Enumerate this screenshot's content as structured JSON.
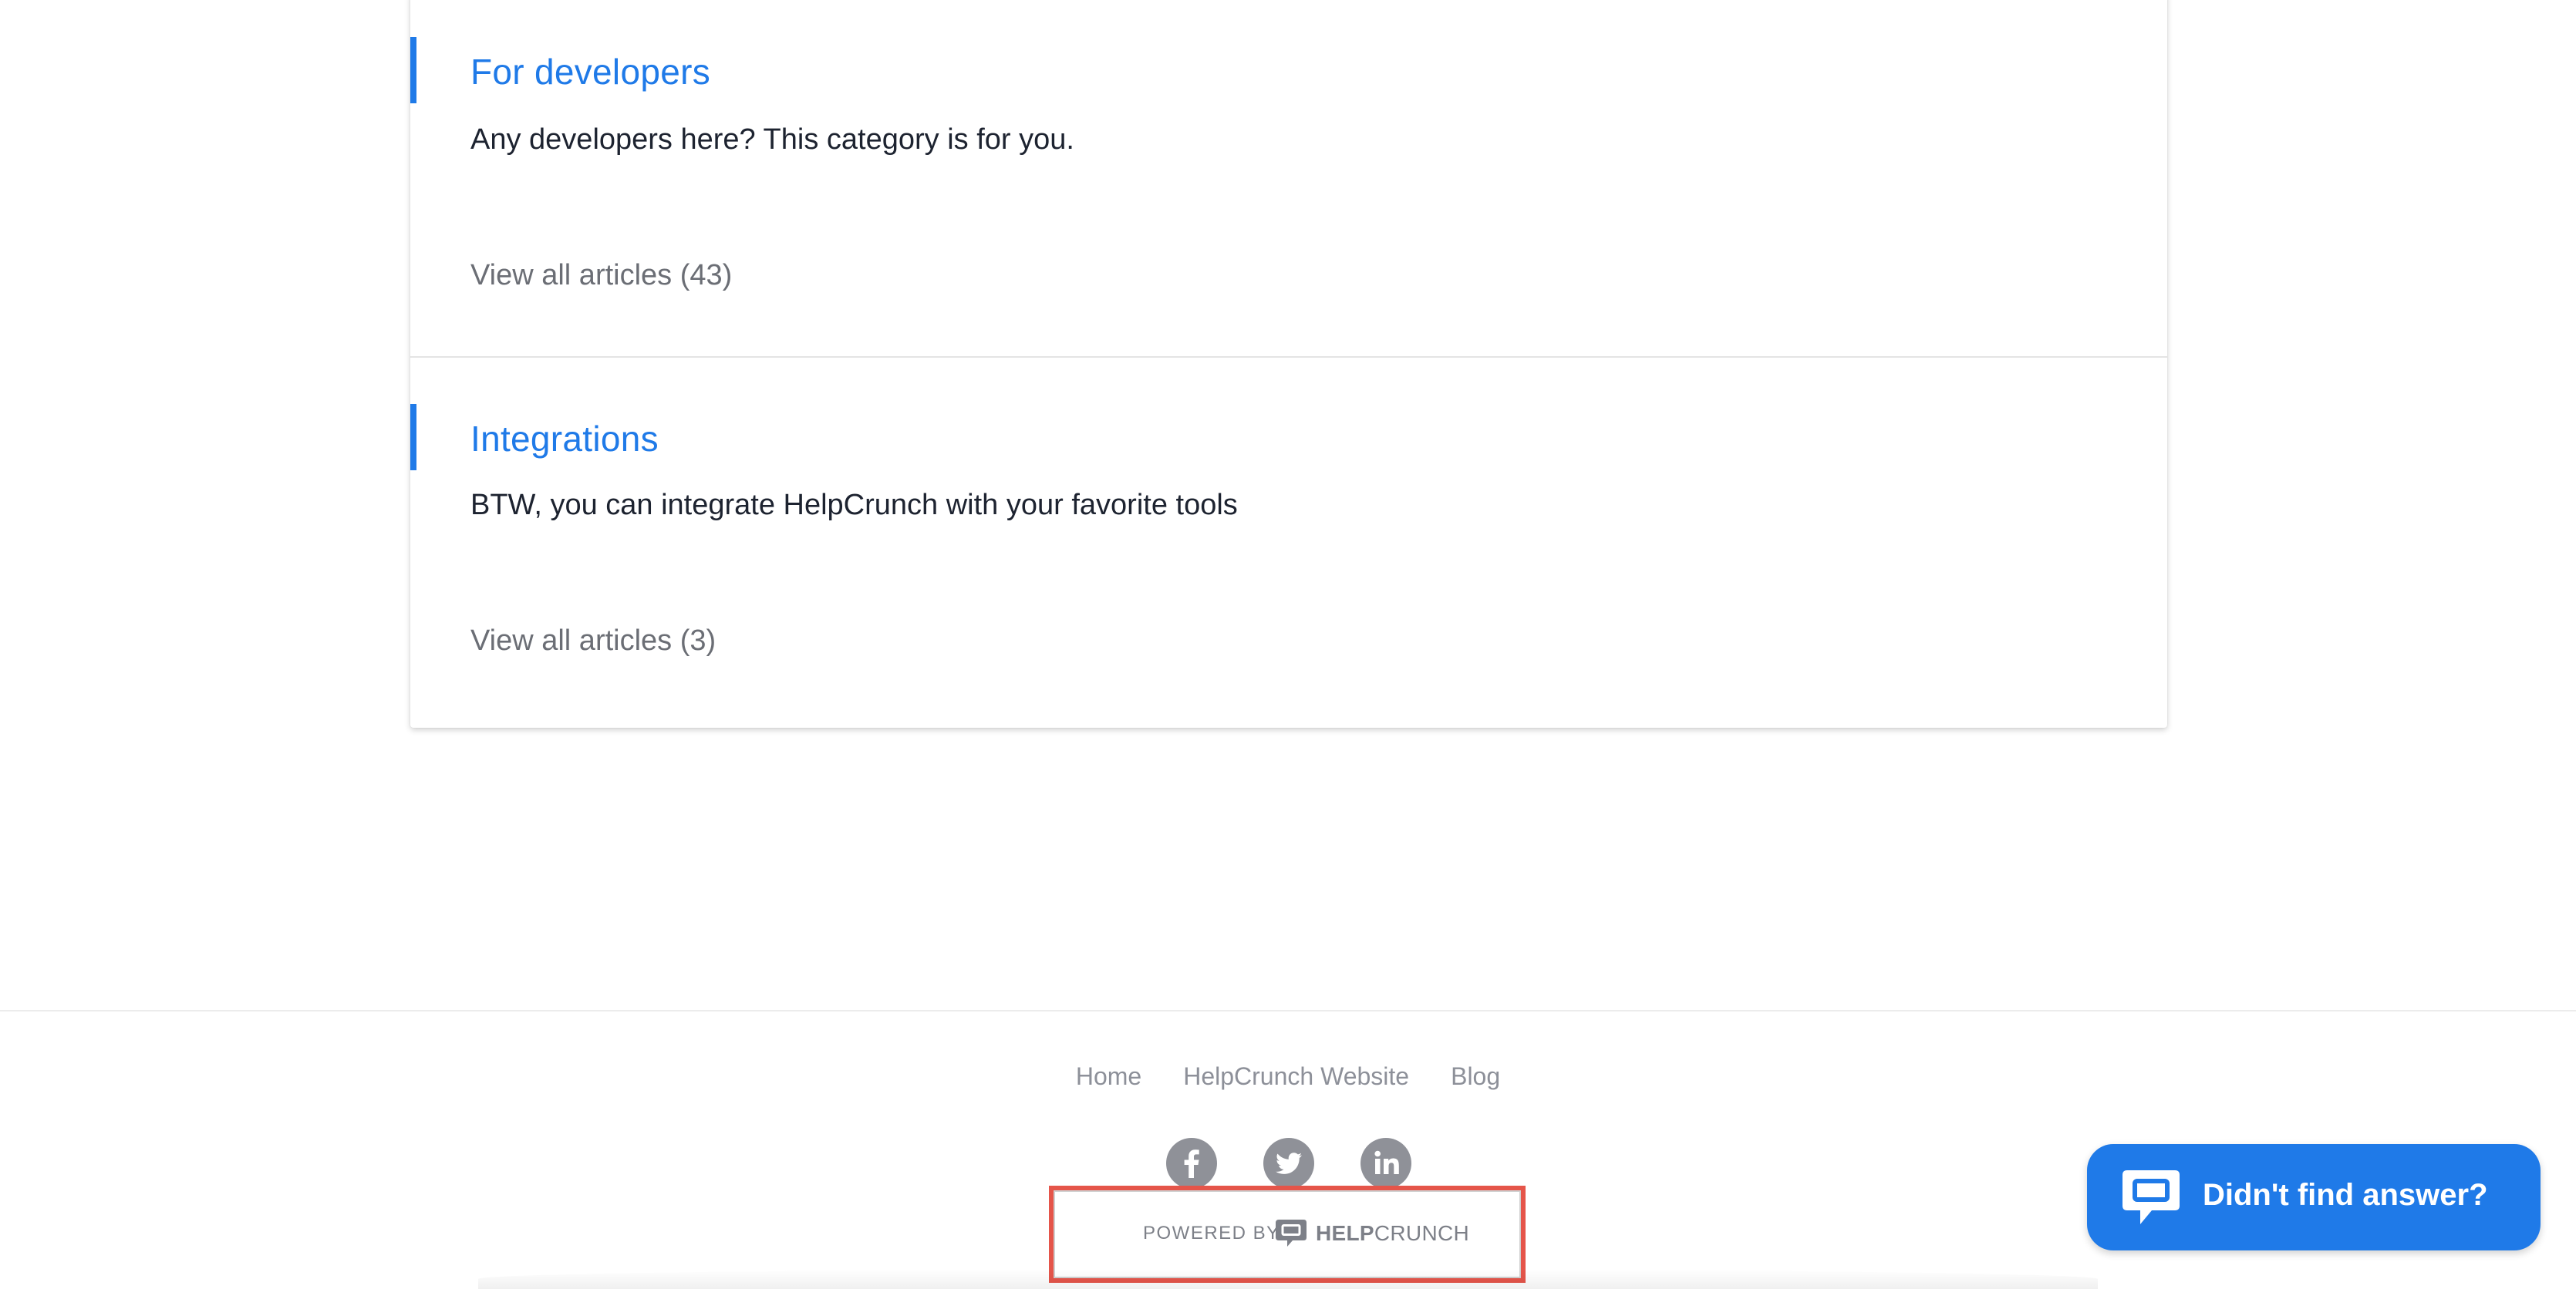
{
  "categories": [
    {
      "title": "For developers",
      "description": "Any developers here? This category is for you.",
      "view_all": "View all articles (43)"
    },
    {
      "title": "Integrations",
      "description": "BTW, you can integrate HelpCrunch with your favorite tools",
      "view_all": "View all articles (3)"
    }
  ],
  "footer": {
    "links": [
      "Home",
      "HelpCrunch Website",
      "Blog"
    ],
    "socials": [
      "facebook-icon",
      "twitter-icon",
      "linkedin-icon"
    ],
    "powered_by": "POWERED BY",
    "brand_bold": "HELP",
    "brand_light": "CRUNCH"
  },
  "chat_widget": {
    "label": "Didn't find answer?"
  },
  "colors": {
    "accent": "#1f7ae8",
    "highlight_border": "#e5554a",
    "social_bg": "#8f9198"
  }
}
